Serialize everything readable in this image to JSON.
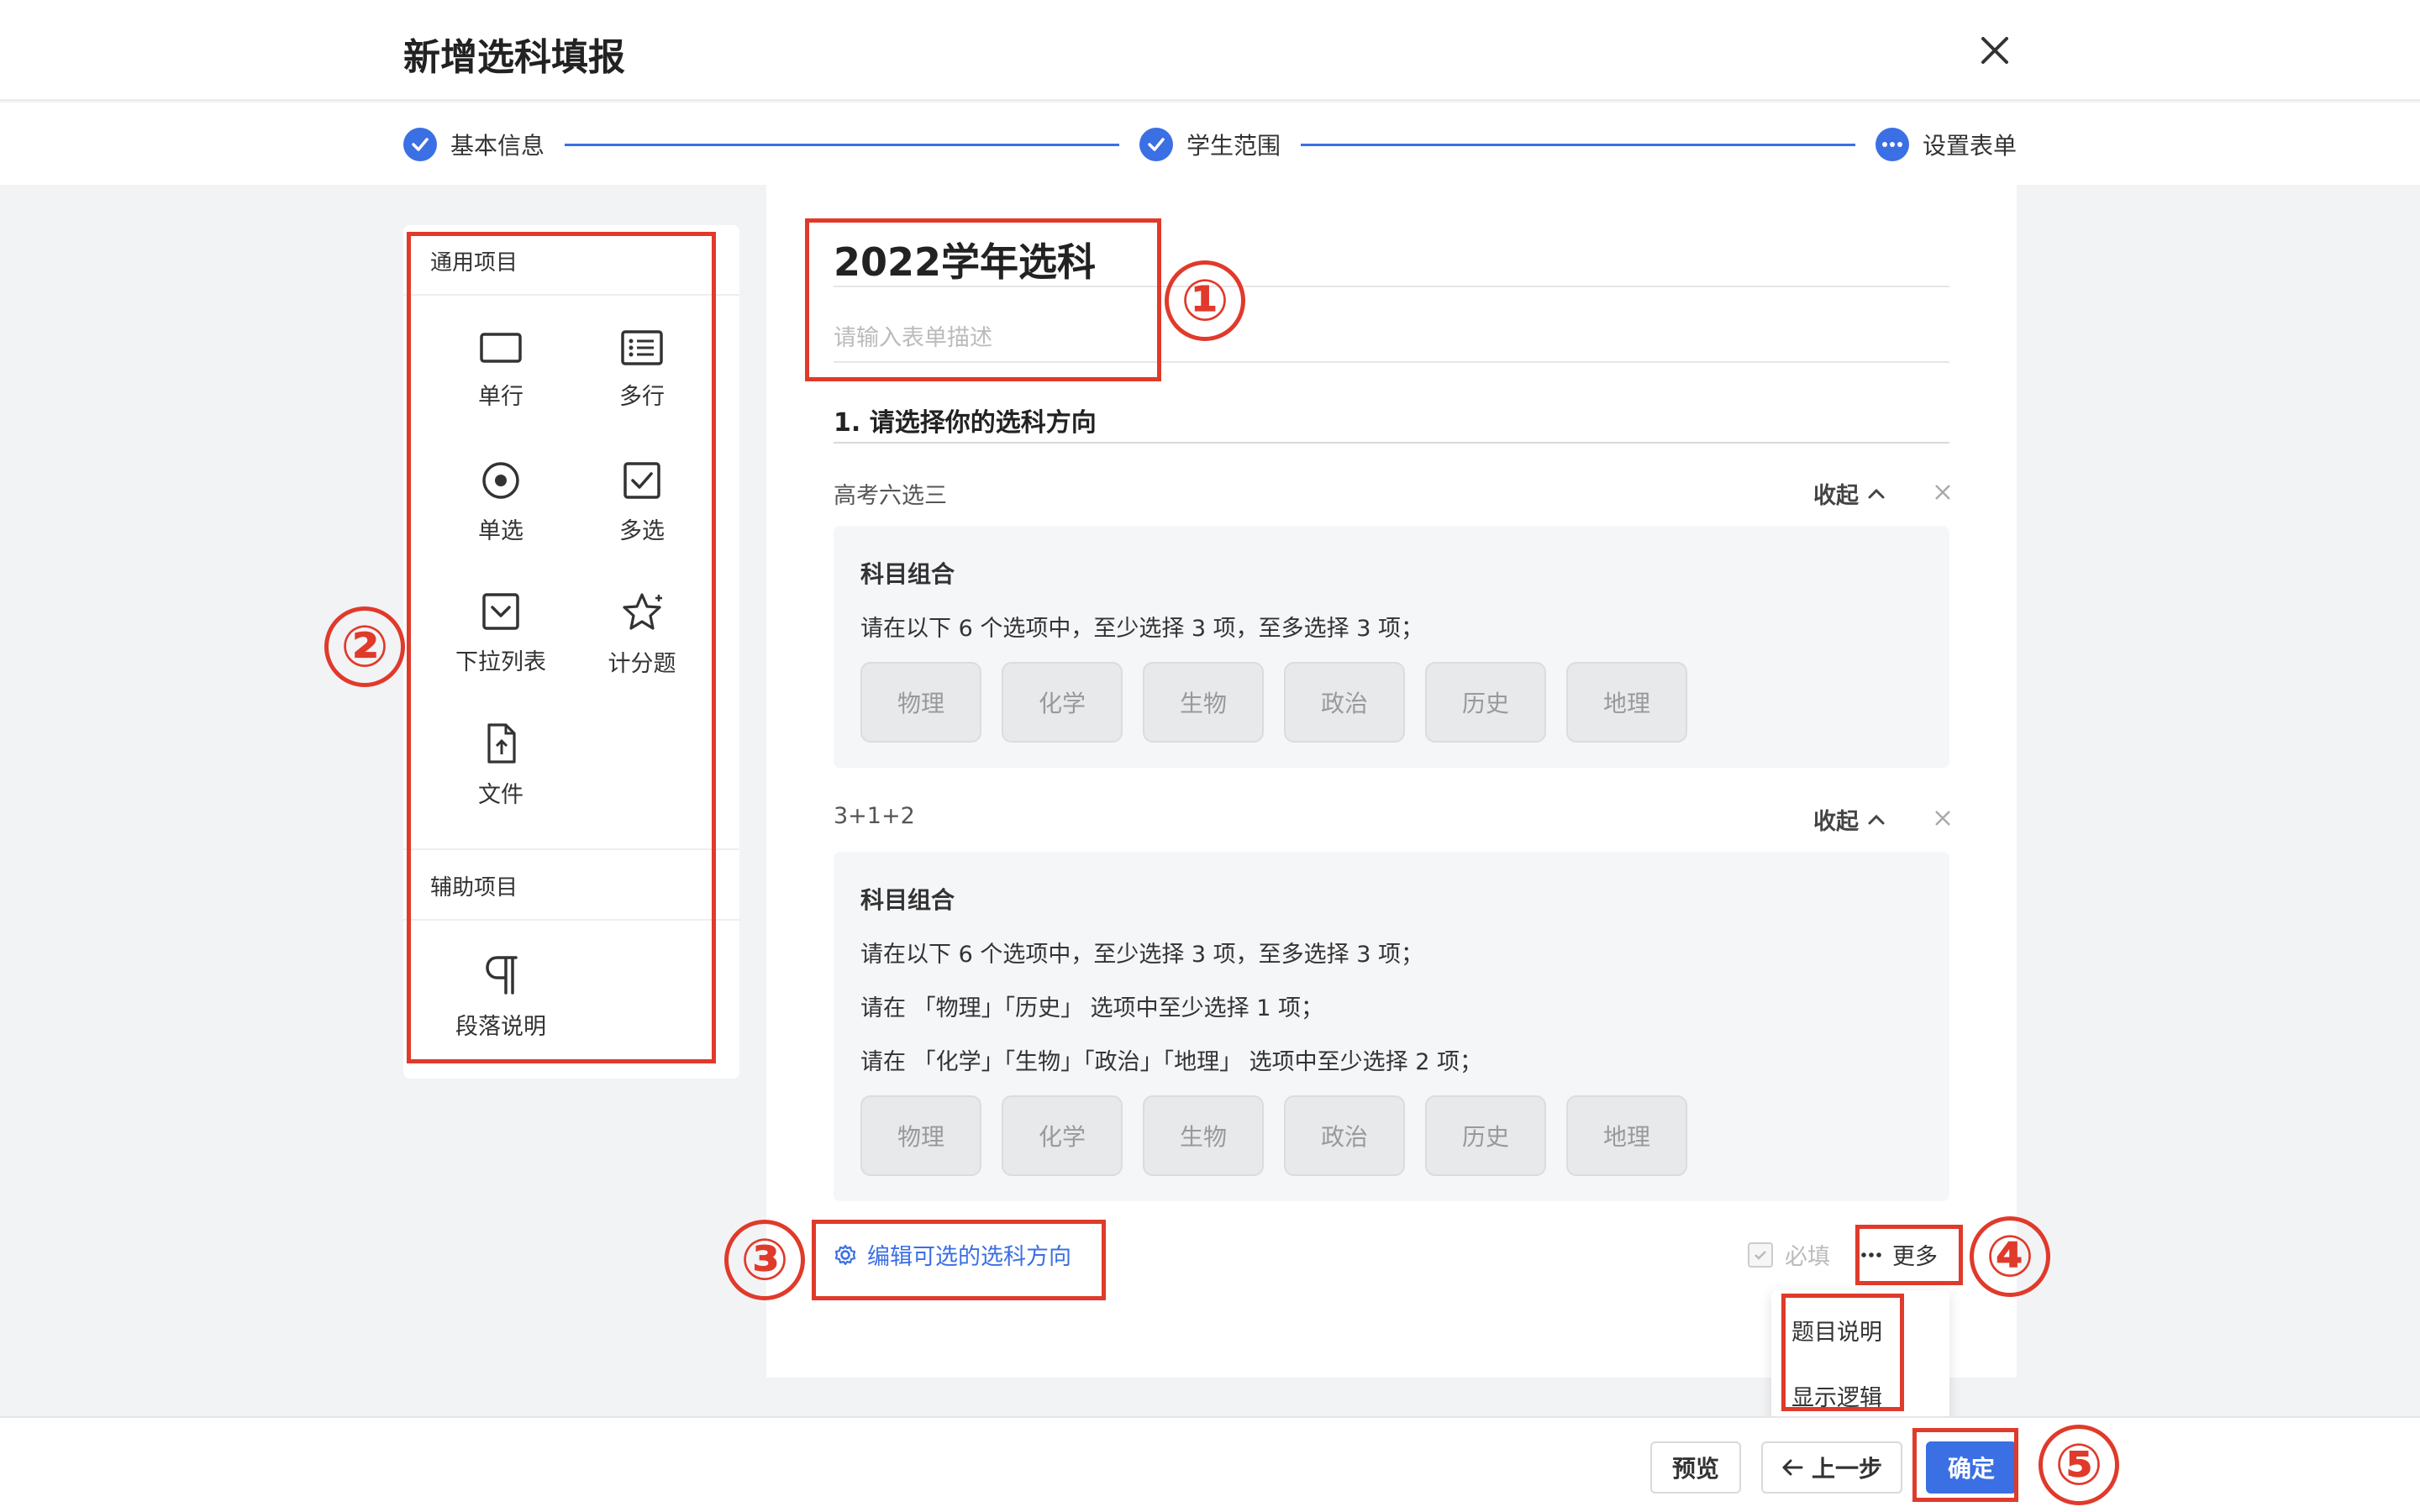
{
  "header": {
    "title": "新增选科填报"
  },
  "steps": [
    {
      "label": "基本信息",
      "state": "done"
    },
    {
      "label": "学生范围",
      "state": "done"
    },
    {
      "label": "设置表单",
      "state": "current"
    }
  ],
  "sidebar": {
    "common_title": "通用项目",
    "common_items": [
      {
        "label": "单行",
        "icon": "single-line-icon"
      },
      {
        "label": "多行",
        "icon": "multi-line-icon"
      },
      {
        "label": "单选",
        "icon": "radio-icon"
      },
      {
        "label": "多选",
        "icon": "checkbox-icon"
      },
      {
        "label": "下拉列表",
        "icon": "dropdown-icon"
      },
      {
        "label": "计分题",
        "icon": "star-icon"
      },
      {
        "label": "文件",
        "icon": "file-upload-icon"
      }
    ],
    "aux_title": "辅助项目",
    "aux_items": [
      {
        "label": "段落说明",
        "icon": "paragraph-icon"
      }
    ]
  },
  "form": {
    "title": "2022学年选科",
    "description_placeholder": "请输入表单描述",
    "question": "1. 请选择你的选科方向",
    "groups": [
      {
        "name": "高考六选三",
        "collapse_label": "收起",
        "box_title": "科目组合",
        "rules": [
          "请在以下 6 个选项中，至少选择 3 项，至多选择 3 项；"
        ],
        "options": [
          "物理",
          "化学",
          "生物",
          "政治",
          "历史",
          "地理"
        ]
      },
      {
        "name": "3+1+2",
        "collapse_label": "收起",
        "box_title": "科目组合",
        "rules": [
          "请在以下 6 个选项中，至少选择 3 项，至多选择 3 项；",
          "请在 「物理」「历史」 选项中至少选择 1 项；",
          "请在 「化学」「生物」「政治」「地理」 选项中至少选择 2 项；"
        ],
        "options": [
          "物理",
          "化学",
          "生物",
          "政治",
          "历史",
          "地理"
        ]
      }
    ],
    "edit_link": "编辑可选的选科方向",
    "required_label": "必填",
    "more_label": "更多",
    "more_menu": [
      "题目说明",
      "显示逻辑"
    ]
  },
  "footer": {
    "preview": "预览",
    "prev": "上一步",
    "confirm": "确定"
  },
  "annotations": [
    "①",
    "②",
    "③",
    "④",
    "⑤"
  ],
  "colors": {
    "primary": "#3b6fe4",
    "annotation": "#e03a2b"
  }
}
